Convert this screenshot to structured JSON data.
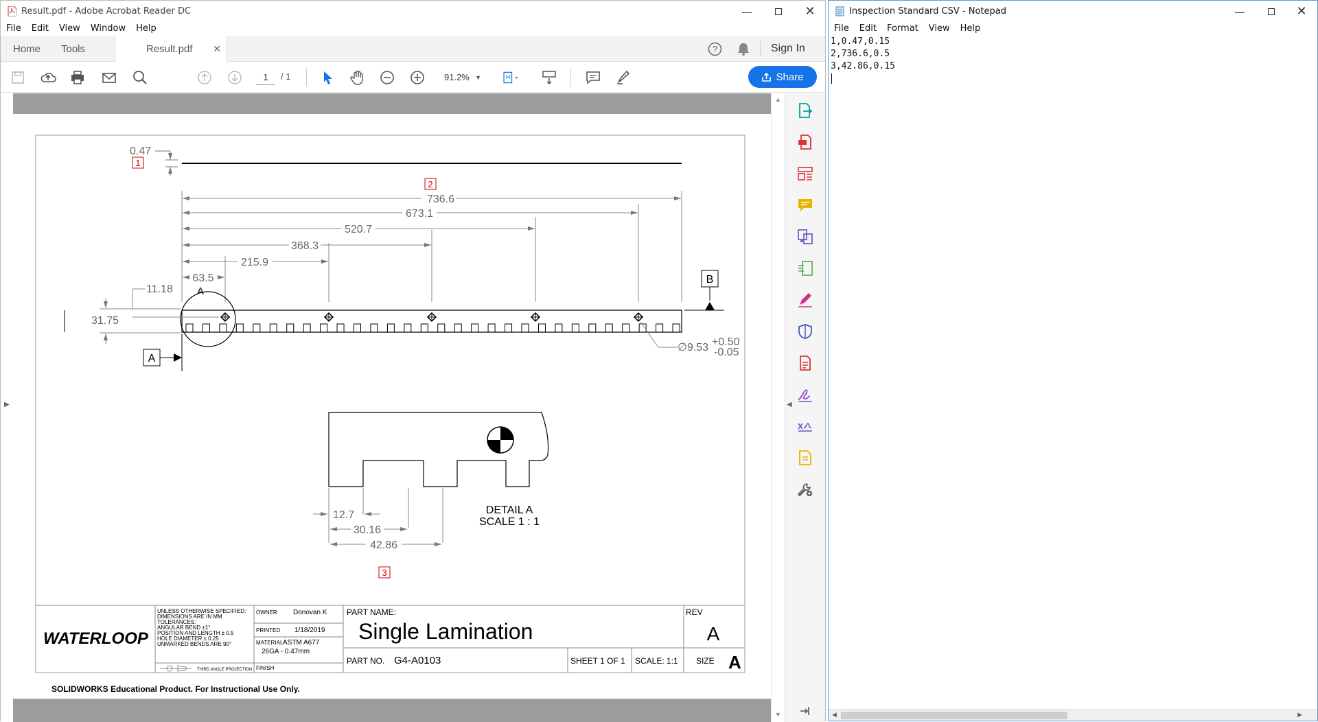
{
  "acrobat": {
    "title": "Result.pdf - Adobe Acrobat Reader DC",
    "menu": [
      "File",
      "Edit",
      "View",
      "Window",
      "Help"
    ],
    "tabs": {
      "home": "Home",
      "tools": "Tools",
      "document": "Result.pdf"
    },
    "sign_in": "Sign In",
    "page_current": "1",
    "page_total": "/ 1",
    "zoom": "91.2%",
    "share": "Share",
    "brand_color": "#1473e6"
  },
  "drawing": {
    "dims": {
      "d047": "0.47",
      "d7366": "736.6",
      "d6731": "673.1",
      "d5207": "520.7",
      "d3683": "368.3",
      "d2159": "215.9",
      "d635": "63.5",
      "d1118": "11.18",
      "d3175": "31.75",
      "hole": "∅9.53",
      "tol_plus": "+0.50",
      "tol_minus": "-0.05",
      "d127": "12.7",
      "d3016": "30.16",
      "d4286": "42.86"
    },
    "balloons": [
      "1",
      "2",
      "3"
    ],
    "datums": {
      "a": "A",
      "b": "B",
      "detail_marker": "A"
    },
    "detail_title": "DETAIL A",
    "detail_scale": "SCALE 1 : 1",
    "title_block": {
      "logo": "WATERLOOP",
      "notes": [
        "UNLESS OTHERWISE SPECIFIED:",
        "DIMENSIONS ARE IN MM",
        "TOLERANCES:",
        "ANGULAR BEND ±1°",
        "POSITION AND LENGTH ± 0.5",
        "HOLE DIAMETER ± 0.25",
        "UNMARKED BENDS ARE 90°"
      ],
      "projection": "THIRD ANGLE PROJECTION",
      "owner_label": "OWNER",
      "owner": "Donovan K",
      "printed_label": "PRINTED",
      "printed": "1/18/2019",
      "material_label": "MATERIAL",
      "material": "ASTM A677",
      "material2": "26GA - 0.47mm",
      "finish_label": "FINISH",
      "part_name_label": "PART NAME:",
      "part_name": "Single Lamination",
      "part_no_label": "PART NO.",
      "part_no": "G4-A0103",
      "sheet": "SHEET 1 OF 1",
      "scale": "SCALE: 1:1",
      "size_label": "SIZE",
      "size": "A",
      "rev_label": "REV",
      "rev": "A"
    },
    "footer_note": "SOLIDWORKS Educational Product. For Instructional Use Only."
  },
  "notepad": {
    "title": "Inspection Standard CSV - Notepad",
    "menu": [
      "File",
      "Edit",
      "Format",
      "View",
      "Help"
    ],
    "content": "1,0.47,0.15\n2,736.6,0.5\n3,42.86,0.15\n"
  }
}
